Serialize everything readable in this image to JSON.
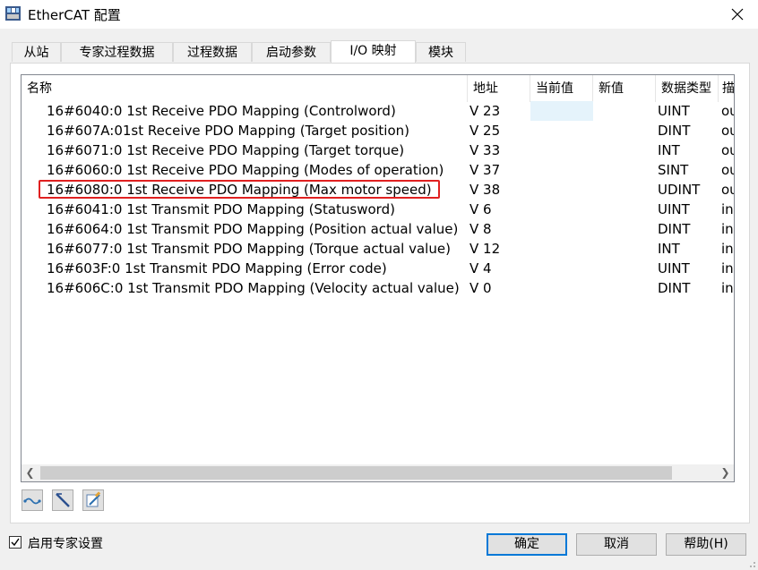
{
  "window": {
    "title": "EtherCAT 配置",
    "app_icon": "ethercat-config-icon",
    "close_icon": "close-icon"
  },
  "tabs": [
    {
      "label": "从站"
    },
    {
      "label": "专家过程数据"
    },
    {
      "label": "过程数据"
    },
    {
      "label": "启动参数"
    },
    {
      "label": "I/O 映射",
      "active": true
    },
    {
      "label": "模块"
    }
  ],
  "table": {
    "columns": [
      "名称",
      "地址",
      "当前值",
      "新值",
      "数据类型",
      "描"
    ],
    "rows": [
      {
        "name": "16#6040:0 1st Receive PDO Mapping (Controlword)",
        "address": "V 23",
        "current": "",
        "new": "",
        "dtype": "UINT",
        "desc": "ou"
      },
      {
        "name": "16#607A:01st Receive PDO Mapping (Target position)",
        "address": "V 25",
        "current": "",
        "new": "",
        "dtype": "DINT",
        "desc": "ou"
      },
      {
        "name": "16#6071:0 1st Receive PDO Mapping (Target torque)",
        "address": "V 33",
        "current": "",
        "new": "",
        "dtype": "INT",
        "desc": "ou"
      },
      {
        "name": "16#6060:0 1st Receive PDO Mapping (Modes of operation)",
        "address": "V 37",
        "current": "",
        "new": "",
        "dtype": "SINT",
        "desc": "ou"
      },
      {
        "name": "16#6080:0 1st Receive PDO Mapping (Max motor speed)",
        "address": "V 38",
        "current": "",
        "new": "",
        "dtype": "UDINT",
        "desc": "ou"
      },
      {
        "name": "16#6041:0 1st Transmit PDO Mapping (Statusword)",
        "address": "V 6",
        "current": "",
        "new": "",
        "dtype": "UINT",
        "desc": "in"
      },
      {
        "name": "16#6064:0 1st Transmit PDO Mapping (Position actual value)",
        "address": "V 8",
        "current": "",
        "new": "",
        "dtype": "DINT",
        "desc": "in"
      },
      {
        "name": "16#6077:0 1st Transmit PDO Mapping (Torque actual value)",
        "address": "V 12",
        "current": "",
        "new": "",
        "dtype": "INT",
        "desc": "in"
      },
      {
        "name": "16#603F:0 1st Transmit PDO Mapping (Error code)",
        "address": "V 4",
        "current": "",
        "new": "",
        "dtype": "UINT",
        "desc": "in"
      },
      {
        "name": "16#606C:0 1st Transmit PDO Mapping (Velocity actual value)",
        "address": "V 0",
        "current": "",
        "new": "",
        "dtype": "DINT",
        "desc": "in"
      }
    ],
    "highlighted_row": 4,
    "highlight_color": "#e02020"
  },
  "toolbar": {
    "icons": [
      "map-variable-icon",
      "clear-mapping-icon",
      "edit-mapping-icon"
    ]
  },
  "footer": {
    "expert_checkbox_label": "启用专家设置",
    "expert_checked": true,
    "ok_label": "确定",
    "cancel_label": "取消",
    "help_label": "帮助(H)"
  },
  "colors": {
    "accent": "#0078d7",
    "cell_highlight": "#e5f3fb"
  }
}
